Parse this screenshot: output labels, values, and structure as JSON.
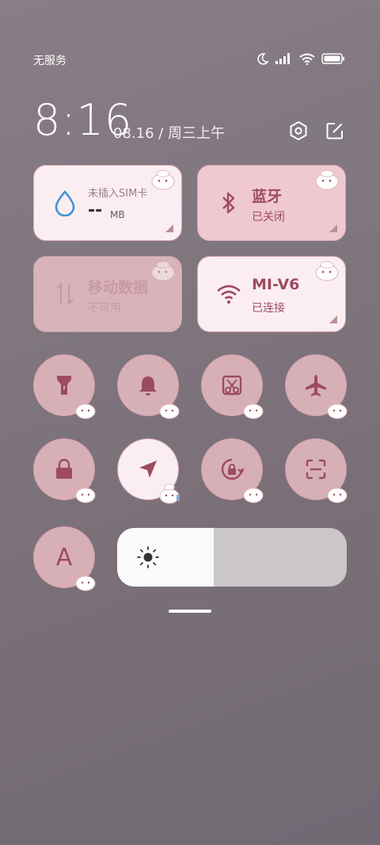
{
  "status_bar": {
    "carrier": "无服务",
    "icons": [
      "moon-icon",
      "signal-icon",
      "wifi-icon",
      "battery-icon"
    ]
  },
  "header": {
    "time": "8:16",
    "date": "08.16 / 周三上午",
    "icons": [
      "settings-icon",
      "edit-icon"
    ]
  },
  "tiles": [
    {
      "title_small": "未插入SIM卡",
      "value": "--",
      "unit": "MB",
      "icon": "water-drop-icon"
    },
    {
      "title": "蓝牙",
      "sub": "已关闭",
      "icon": "bluetooth-icon"
    },
    {
      "title": "移动数据",
      "sub": "不可用",
      "icon": "data-arrows-icon"
    },
    {
      "title": "MI-V6",
      "sub": "已连接",
      "icon": "wifi-icon"
    }
  ],
  "toggles": [
    "flashlight-icon",
    "bell-icon",
    "screenshot-icon",
    "airplane-icon",
    "lock-icon",
    "location-icon",
    "rotation-lock-icon",
    "scan-icon",
    "font-icon"
  ],
  "font_toggle_letter": "A",
  "brightness": {
    "level": 0.42,
    "icon": "sun-icon"
  },
  "colors": {
    "accent": "#9d4b60",
    "tile_light": "#fbeef2",
    "tile_pink": "#efc9cf"
  }
}
